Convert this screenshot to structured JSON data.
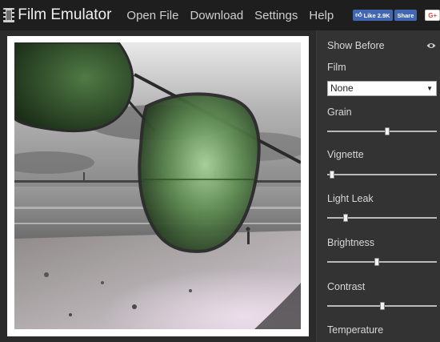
{
  "header": {
    "title": "Film Emulator",
    "nav": [
      {
        "label": "Open File"
      },
      {
        "label": "Download"
      },
      {
        "label": "Settings"
      },
      {
        "label": "Help"
      }
    ],
    "fb_like_label": "Like 2.9K",
    "fb_share_label": "Share",
    "gplus_label": "G+"
  },
  "photo": {
    "description_icon": "image-preview"
  },
  "panel": {
    "show_before_label": "Show Before",
    "film_label": "Film",
    "film_value": "None",
    "sliders": [
      {
        "label": "Grain",
        "value": 0.55
      },
      {
        "label": "Vignette",
        "value": 0.02
      },
      {
        "label": "Light Leak",
        "value": 0.15
      },
      {
        "label": "Brightness",
        "value": 0.45
      },
      {
        "label": "Contrast",
        "value": 0.5
      }
    ],
    "temperature_label": "Temperature"
  },
  "colors": {
    "topbar": "#1e1e1e",
    "panel": "#333333",
    "facebook": "#4267b2",
    "gplus": "#dd4b39"
  }
}
